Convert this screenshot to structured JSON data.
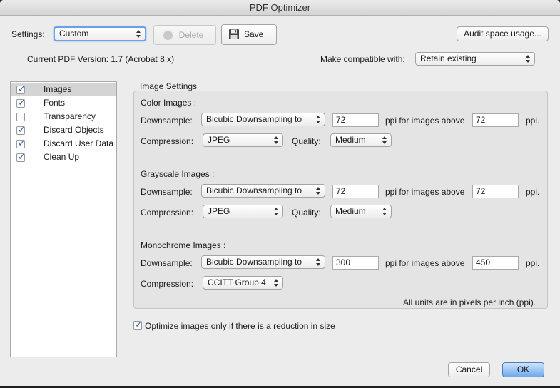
{
  "window": {
    "title": "PDF Optimizer"
  },
  "header": {
    "settings_label": "Settings:",
    "settings_value": "Custom",
    "delete_label": "Delete",
    "save_label": "Save",
    "audit_label": "Audit space usage...",
    "current_version": "Current PDF Version: 1.7 (Acrobat 8.x)",
    "compat_label": "Make compatible with:",
    "compat_value": "Retain existing"
  },
  "sidebar": {
    "items": [
      {
        "label": "Images",
        "checked": true
      },
      {
        "label": "Fonts",
        "checked": true
      },
      {
        "label": "Transparency",
        "checked": false
      },
      {
        "label": "Discard Objects",
        "checked": true
      },
      {
        "label": "Discard User Data",
        "checked": true
      },
      {
        "label": "Clean Up",
        "checked": true
      }
    ]
  },
  "image_settings": {
    "title": "Image Settings",
    "color": {
      "heading": "Color Images :",
      "downsample_label": "Downsample:",
      "downsample_method": "Bicubic Downsampling to",
      "ppi": "72",
      "above_label": "ppi for images above",
      "above_ppi": "72",
      "ppi_suffix": "ppi.",
      "compression_label": "Compression:",
      "compression": "JPEG",
      "quality_label": "Quality:",
      "quality": "Medium"
    },
    "grayscale": {
      "heading": "Grayscale Images :",
      "downsample_label": "Downsample:",
      "downsample_method": "Bicubic Downsampling to",
      "ppi": "72",
      "above_label": "ppi for images above",
      "above_ppi": "72",
      "ppi_suffix": "ppi.",
      "compression_label": "Compression:",
      "compression": "JPEG",
      "quality_label": "Quality:",
      "quality": "Medium"
    },
    "monochrome": {
      "heading": "Monochrome Images :",
      "downsample_label": "Downsample:",
      "downsample_method": "Bicubic Downsampling to",
      "ppi": "300",
      "above_label": "ppi for images above",
      "above_ppi": "450",
      "ppi_suffix": "ppi.",
      "compression_label": "Compression:",
      "compression": "CCITT Group 4"
    },
    "units_note": "All units are in pixels per inch (ppi).",
    "optimize_label": "Optimize images only if there is a reduction in size"
  },
  "footer": {
    "cancel_label": "Cancel",
    "ok_label": "OK"
  },
  "colors": {
    "accent": "#6fa9ec",
    "check": "#2a5fb0"
  }
}
